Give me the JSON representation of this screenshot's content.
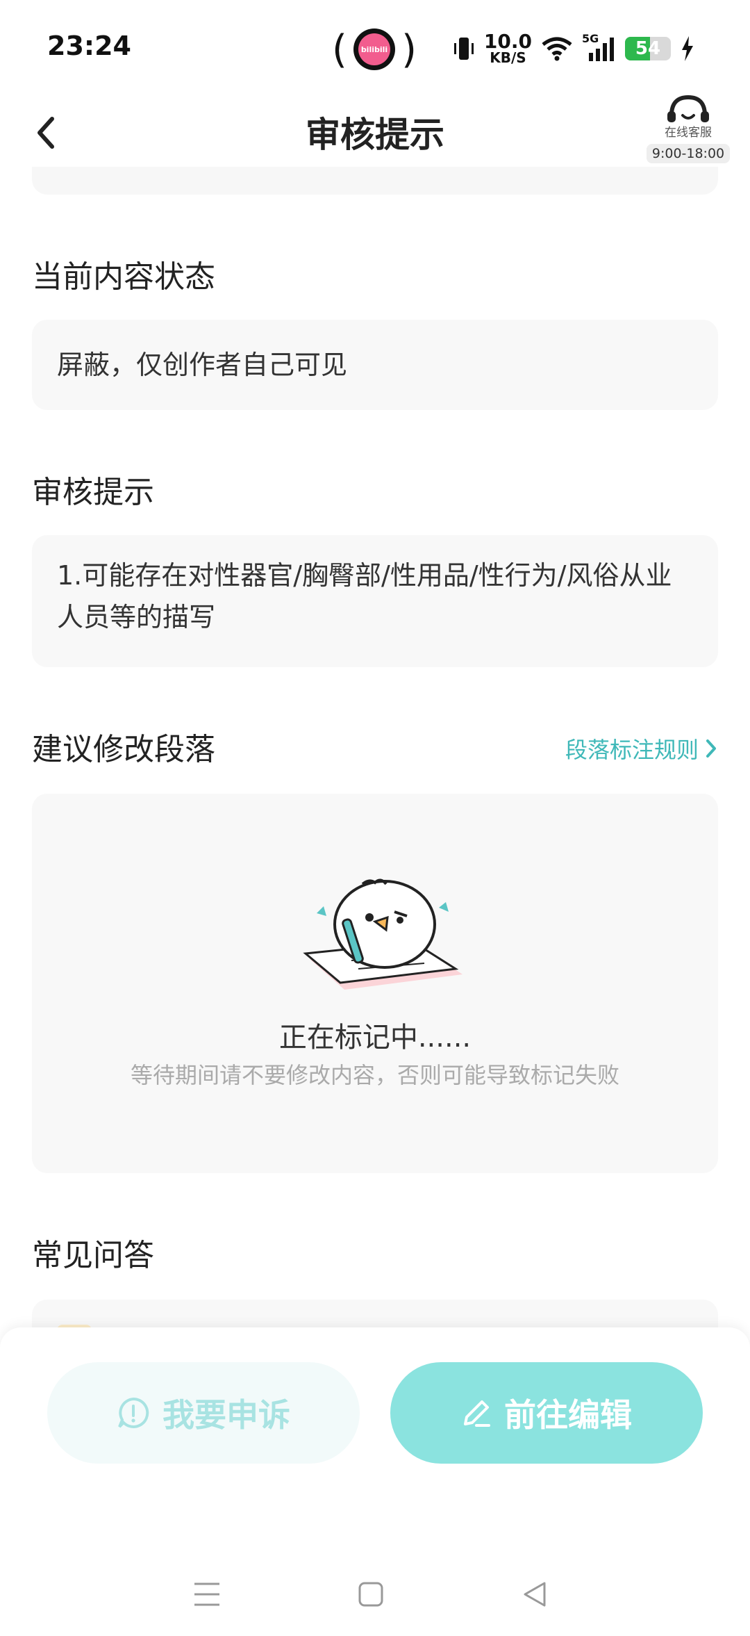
{
  "status_bar": {
    "time": "23:24",
    "net_speed_value": "10.0",
    "net_speed_unit": "KB/S",
    "network": "5G",
    "battery": "54",
    "battery_level": 0.54,
    "app_badge": "bilibili"
  },
  "header": {
    "title": "审核提示",
    "customer_service_label": "在线客服",
    "customer_service_hours": "9:00-18:00"
  },
  "sections": {
    "status_title": "当前内容状态",
    "status_value": "屏蔽，仅创作者自己可见",
    "review_title": "审核提示",
    "review_value": "1.可能存在对性器官/胸臀部/性用品/性行为/风俗从业人员等的描写",
    "suggest_title": "建议修改段落",
    "rules_link": "段落标注规则",
    "marking_title": "正在标记中......",
    "marking_sub": "等待期间请不要修改内容，否则可能导致标记失败",
    "faq_title": "常见问答"
  },
  "actions": {
    "appeal_label": "我要申诉",
    "edit_label": "前往编辑"
  },
  "colors": {
    "accent": "#3fb8b8",
    "edit_button": "#8be3df",
    "appeal_button_bg": "#f2fafa",
    "appeal_button_text": "#a8e3e2",
    "card_bg": "#f8f8f8"
  }
}
